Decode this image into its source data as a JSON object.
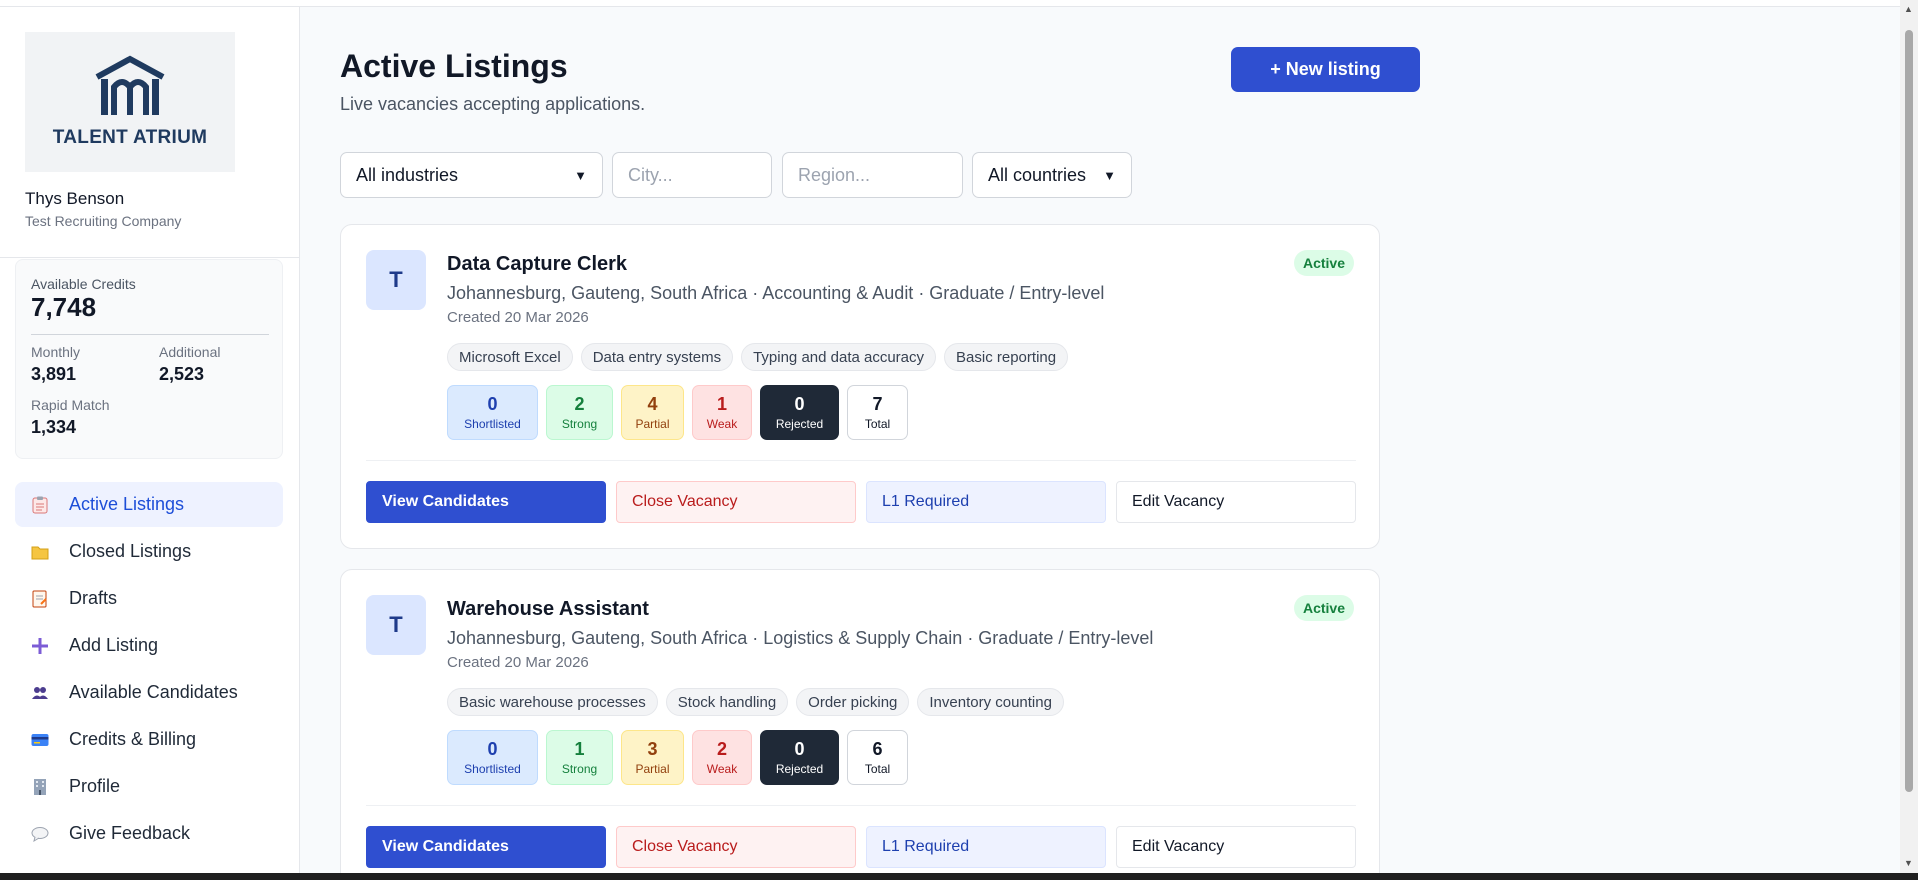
{
  "brand": {
    "name": "TALENT ATRIUM",
    "logo_icon": "building-icon",
    "color": "#1f3a5f"
  },
  "user": {
    "name": "Thys Benson",
    "company": "Test Recruiting Company"
  },
  "credits": {
    "available_label": "Available Credits",
    "available": "7,748",
    "monthly_label": "Monthly",
    "monthly": "3,891",
    "additional_label": "Additional",
    "additional": "2,523",
    "rapid_label": "Rapid Match",
    "rapid": "1,334"
  },
  "nav": [
    {
      "label": "Active Listings",
      "icon": "clipboard-icon",
      "active": true
    },
    {
      "label": "Closed Listings",
      "icon": "folder-icon"
    },
    {
      "label": "Drafts",
      "icon": "memo-icon"
    },
    {
      "label": "Add Listing",
      "icon": "plus-icon"
    },
    {
      "label": "Available Candidates",
      "icon": "people-icon"
    },
    {
      "label": "Credits & Billing",
      "icon": "credit-card-icon"
    },
    {
      "label": "Profile",
      "icon": "office-building-icon"
    },
    {
      "label": "Give Feedback",
      "icon": "speech-bubble-icon"
    }
  ],
  "page": {
    "title": "Active Listings",
    "subtitle": "Live vacancies accepting applications.",
    "new_button": "+ New listing"
  },
  "filters": {
    "industry": "All industries",
    "city_placeholder": "City...",
    "region_placeholder": "Region...",
    "country": "All countries"
  },
  "colors": {
    "primary": "#2f4fd0",
    "active_badge": "#15803d"
  },
  "listings": [
    {
      "avatar": "T",
      "title": "Data Capture Clerk",
      "meta": "Johannesburg, Gauteng, South Africa · Accounting & Audit · Graduate / Entry-level",
      "created": "Created 20 Mar 2026",
      "status": "Active",
      "tags": [
        "Microsoft Excel",
        "Data entry systems",
        "Typing and data accuracy",
        "Basic reporting"
      ],
      "stats": {
        "shortlisted": "0",
        "strong": "2",
        "partial": "4",
        "weak": "1",
        "rejected": "0",
        "total": "7"
      },
      "actions": {
        "view": "View Candidates",
        "close": "Close Vacancy",
        "l1": "L1 Required",
        "edit": "Edit Vacancy"
      }
    },
    {
      "avatar": "T",
      "title": "Warehouse Assistant",
      "meta": "Johannesburg, Gauteng, South Africa · Logistics & Supply Chain · Graduate / Entry-level",
      "created": "Created 20 Mar 2026",
      "status": "Active",
      "tags": [
        "Basic warehouse processes",
        "Stock handling",
        "Order picking",
        "Inventory counting"
      ],
      "stats": {
        "shortlisted": "0",
        "strong": "1",
        "partial": "3",
        "weak": "2",
        "rejected": "0",
        "total": "6"
      },
      "actions": {
        "view": "View Candidates",
        "close": "Close Vacancy",
        "l1": "L1 Required",
        "edit": "Edit Vacancy"
      }
    }
  ],
  "stat_labels": {
    "shortlisted": "Shortlisted",
    "strong": "Strong",
    "partial": "Partial",
    "weak": "Weak",
    "rejected": "Rejected",
    "total": "Total"
  }
}
